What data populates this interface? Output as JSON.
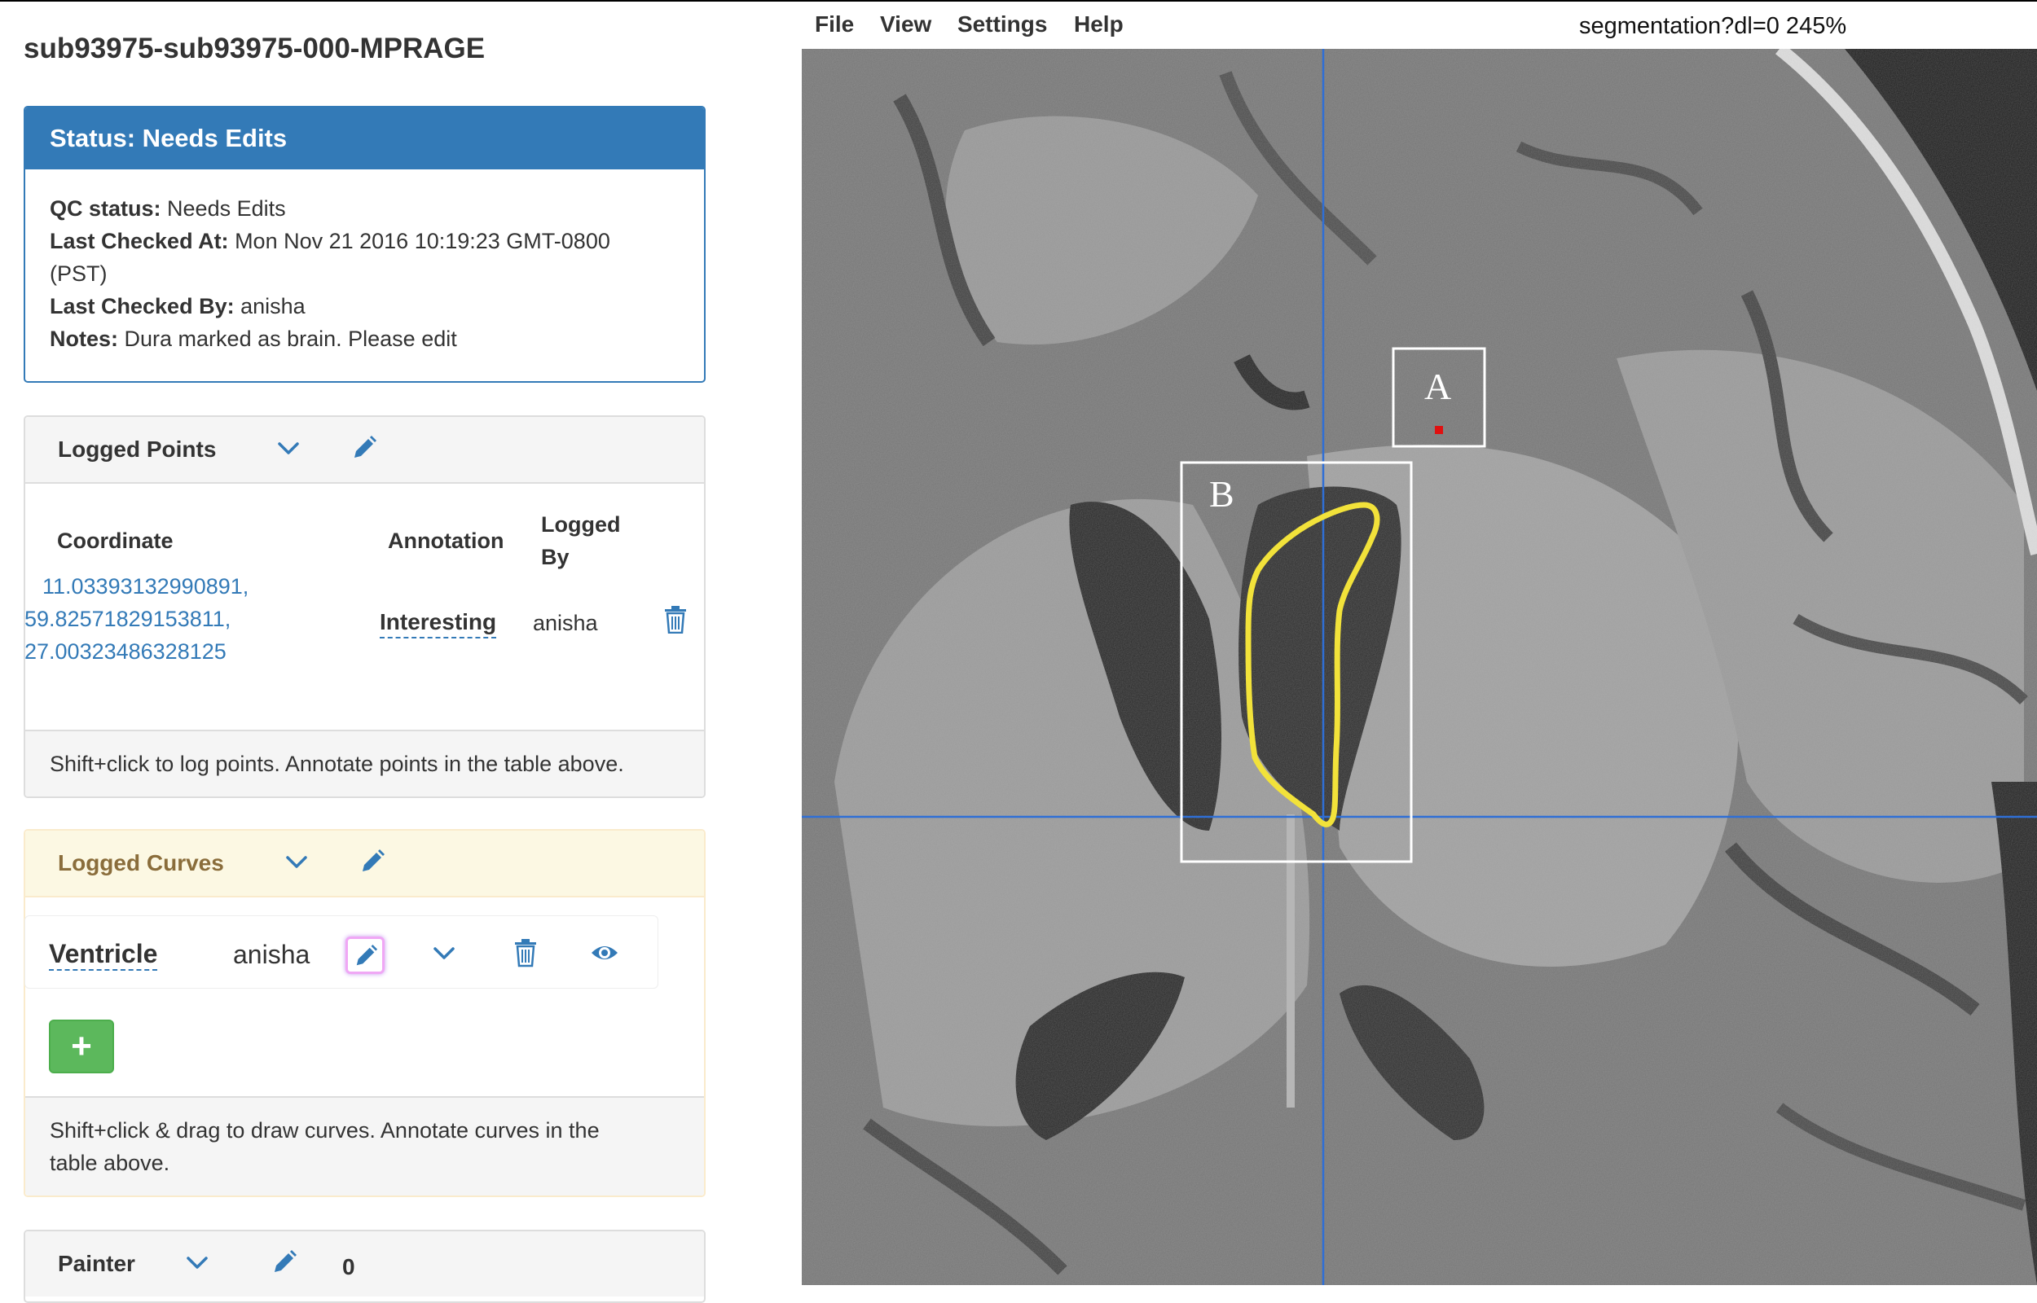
{
  "page": {
    "title": "sub93975-sub93975-000-MPRAGE"
  },
  "status": {
    "heading": "Status: Needs Edits",
    "qc_label": "QC status:",
    "qc_value": "Needs Edits",
    "checked_at_label": "Last Checked At:",
    "checked_at_value": "Mon Nov 21 2016 10:19:23 GMT-0800",
    "checked_at_tz": "(PST)",
    "checked_by_label": "Last Checked By:",
    "checked_by_value": "anisha",
    "notes_label": "Notes:",
    "notes_value": "Dura marked as brain. Please edit"
  },
  "logged_points": {
    "title": "Logged Points",
    "columns": {
      "coordinate": "Coordinate",
      "annotation": "Annotation",
      "logged_by_1": "Logged",
      "logged_by_2": "By"
    },
    "rows": [
      {
        "coord_x": "11.03393132990891,",
        "coord_y": "59.82571829153811,",
        "coord_z": "27.00323486328125",
        "annotation": "Interesting",
        "logged_by": "anisha"
      }
    ],
    "footer": "Shift+click to log points. Annotate points in the table above.",
    "icons": {
      "toggle": "chevron-down-icon",
      "edit": "pencil-icon",
      "delete": "trash-icon"
    }
  },
  "logged_curves": {
    "title": "Logged Curves",
    "rows": [
      {
        "name": "Ventricle",
        "user": "anisha"
      }
    ],
    "add_label": "+",
    "footer_line1": "Shift+click & drag to draw curves. Annotate curves in the",
    "footer_line2": "table above.",
    "icons": {
      "toggle": "chevron-down-icon",
      "edit": "pencil-icon",
      "delete": "trash-icon",
      "visibility": "eye-icon"
    }
  },
  "painter": {
    "title": "Painter",
    "count": "0"
  },
  "menu": {
    "file": "File",
    "view": "View",
    "settings": "Settings",
    "help": "Help"
  },
  "viewer": {
    "status": "segmentation?dl=0 245%",
    "box_a_label": "A",
    "box_b_label": "B",
    "colors": {
      "crosshair": "#2f6fd6",
      "curve": "#f2e23a",
      "box": "#ffffff",
      "point": "#e01010"
    }
  },
  "colors": {
    "primary": "#337ab7",
    "warning_bg": "#fcf8e3",
    "warning_text": "#8a6d3b",
    "success": "#5cb85c"
  }
}
